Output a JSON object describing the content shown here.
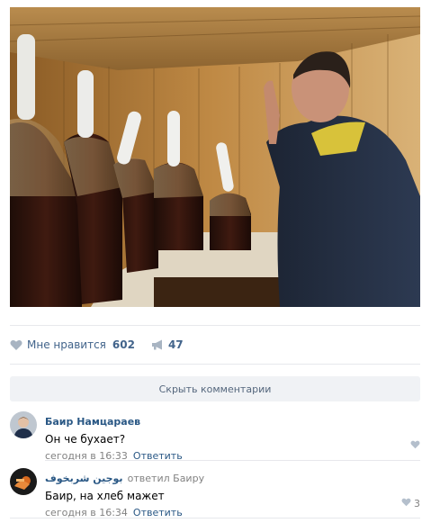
{
  "post": {
    "likes_label": "Мне нравится",
    "likes_count": "602",
    "shares_count": "47",
    "hide_comments_label": "Скрыть комментарии"
  },
  "comments": [
    {
      "author": "Баир Намцараев",
      "replied_to": "",
      "text": "Он че бухает?",
      "time": "сегодня в 16:33",
      "reply_label": "Ответить",
      "likes": ""
    },
    {
      "author": "بوجين شربخوف",
      "replied_to": "ответил Баиру",
      "text": "Баир, на хлеб мажет",
      "time": "сегодня в 16:34",
      "reply_label": "Ответить",
      "likes": "3"
    }
  ],
  "colors": {
    "link": "#2a5885",
    "muted": "#828282",
    "button_bg": "#f0f2f5",
    "separator": "#e7e8ec"
  },
  "icons": [
    "heart-icon",
    "megaphone-icon"
  ]
}
